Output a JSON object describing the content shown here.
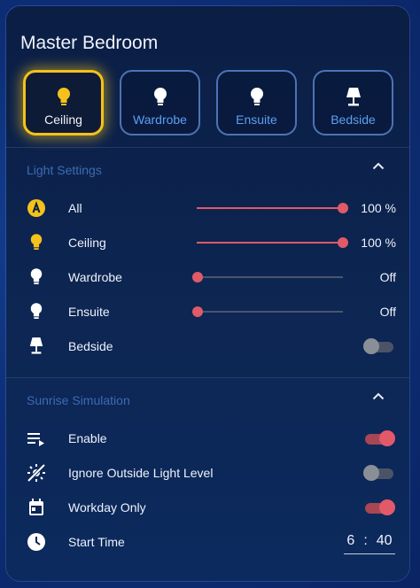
{
  "card": {
    "title": "Master Bedroom",
    "tiles": [
      {
        "label": "Ceiling",
        "icon": "lightbulb-icon",
        "active": true
      },
      {
        "label": "Wardrobe",
        "icon": "lightbulb-icon",
        "active": false
      },
      {
        "label": "Ensuite",
        "icon": "lightbulb-icon",
        "active": false
      },
      {
        "label": "Bedside",
        "icon": "lamp-icon",
        "active": false
      }
    ]
  },
  "light_settings": {
    "heading": "Light Settings",
    "rows": [
      {
        "label": "All",
        "icon": "auto-brightness-icon",
        "value": "100 %",
        "level": 100
      },
      {
        "label": "Ceiling",
        "icon": "lightbulb-icon",
        "value": "100 %",
        "level": 100
      },
      {
        "label": "Wardrobe",
        "icon": "lightbulb-icon",
        "value": "Off",
        "level": 0
      },
      {
        "label": "Ensuite",
        "icon": "lightbulb-icon",
        "value": "Off",
        "level": 0
      },
      {
        "label": "Bedside",
        "icon": "lamp-icon",
        "toggle": false
      }
    ]
  },
  "sunrise": {
    "heading": "Sunrise Simulation",
    "rows": [
      {
        "label": "Enable",
        "icon": "playlist-play-icon",
        "toggle": true
      },
      {
        "label": "Ignore Outside Light Level",
        "icon": "weather-sunny-off-icon",
        "toggle": false
      },
      {
        "label": "Workday Only",
        "icon": "calendar-today-icon",
        "toggle": true
      }
    ],
    "start_time": {
      "label": "Start Time",
      "icon": "clock-icon",
      "hour": "6",
      "separator": ":",
      "minute": "40"
    }
  },
  "colors": {
    "accent_active": "#f4c21a",
    "slider": "#e05a68",
    "section_text": "#3d6bb4",
    "tile_text": "#5e9ff0"
  }
}
